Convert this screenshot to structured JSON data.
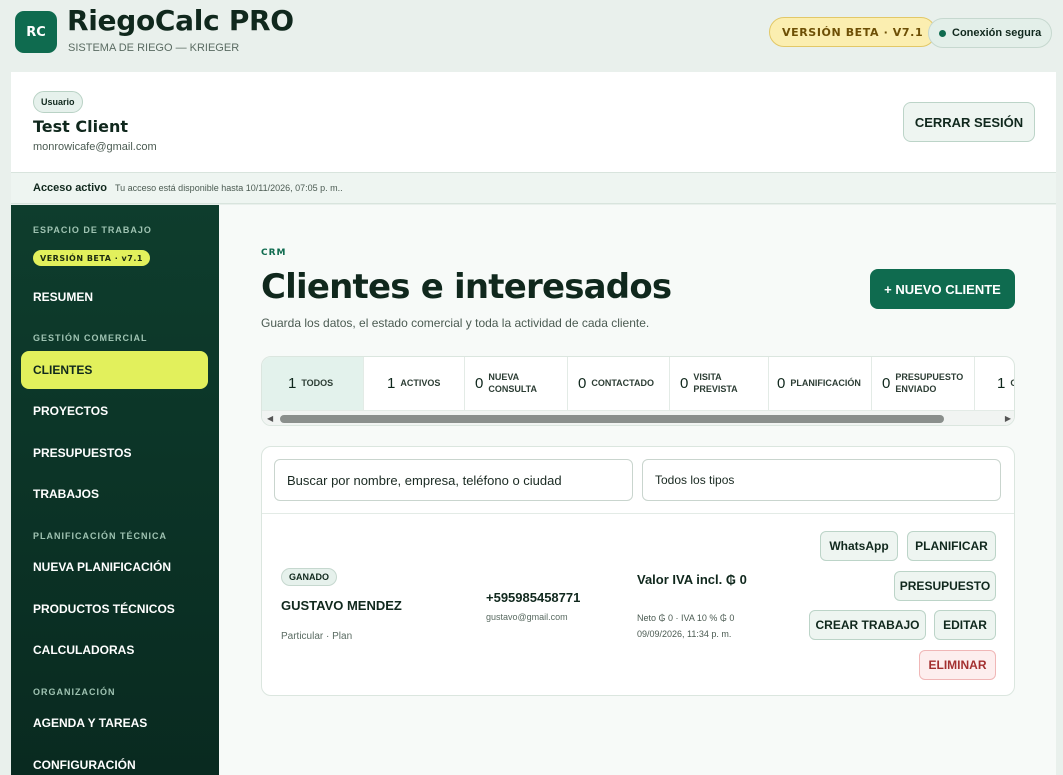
{
  "app": {
    "logo": "RC",
    "title": "RiegoCalc PRO",
    "subtitle": "SISTEMA DE RIEGO — KRIEGER",
    "beta": "VERSIÓN BETA · V7.1",
    "secure": "Conexión segura"
  },
  "user": {
    "role": "Usuario",
    "name": "Test Client",
    "email": "monrowicafe@gmail.com",
    "logout": "CERRAR SESIÓN"
  },
  "access": {
    "label": "Acceso activo",
    "text": "Tu acceso está disponible hasta 10/11/2026, 07:05 p. m.."
  },
  "sidebar": {
    "section_workspace": "ESPACIO DE TRABAJO",
    "beta": "VERSIÓN BETA · v7.1",
    "summary": "RESUMEN",
    "section_commercial": "GESTIÓN COMERCIAL",
    "clients": "CLIENTES",
    "projects": "PROYECTOS",
    "budgets": "PRESUPUESTOS",
    "jobs": "TRABAJOS",
    "section_technical": "PLANIFICACIÓN TÉCNICA",
    "new_planning": "NUEVA PLANIFICACIÓN",
    "technical_products": "PRODUCTOS TÉCNICOS",
    "calculators": "CALCULADORAS",
    "section_org": "ORGANIZACIÓN",
    "agenda": "AGENDA Y TAREAS",
    "config": "CONFIGURACIÓN"
  },
  "main": {
    "kicker": "CRM",
    "title": "Clientes e interesados",
    "description": "Guarda los datos, el estado comercial y toda la actividad de cada cliente.",
    "new_client": "+ NUEVO CLIENTE",
    "tabs": [
      {
        "count": "1",
        "label": "TODOS"
      },
      {
        "count": "1",
        "label": "ACTIVOS"
      },
      {
        "count": "0",
        "label": "NUEVA CONSULTA"
      },
      {
        "count": "0",
        "label": "CONTACTADO"
      },
      {
        "count": "0",
        "label": "VISITA PREVISTA"
      },
      {
        "count": "0",
        "label": "PLANIFICACIÓN"
      },
      {
        "count": "0",
        "label": "PRESUPUESTO ENVIADO"
      },
      {
        "count": "1",
        "label": "G"
      }
    ],
    "search_placeholder": "Buscar por nombre, empresa, teléfono o ciudad",
    "type_filter": "Todos los tipos"
  },
  "client": {
    "status": "GANADO",
    "name": "GUSTAVO MENDEZ",
    "meta": "Particular · Plan",
    "phone": "+595985458771",
    "email": "gustavo@gmail.com",
    "value": "Valor IVA incl. ₲ 0",
    "net": "Neto ₲ 0 · IVA 10 % ₲ 0",
    "date": "09/09/2026, 11:34 p. m.",
    "actions": {
      "whatsapp": "WhatsApp",
      "plan": "PLANIFICAR",
      "budget": "PRESUPUESTO",
      "create_job": "CREAR TRABAJO",
      "edit": "EDITAR",
      "delete": "ELIMINAR"
    }
  }
}
